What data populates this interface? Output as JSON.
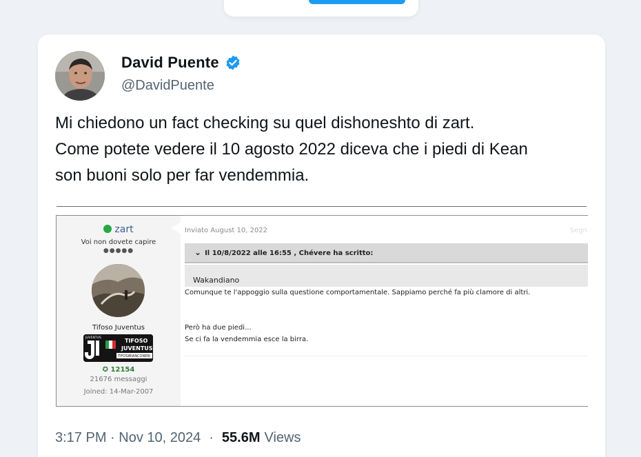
{
  "author": {
    "name": "David Puente",
    "handle": "@DavidPuente"
  },
  "tweet": {
    "lines": [
      "Mi chiedono un fact checking su quel dishoneshto di zart.",
      "Come potete vedere il 10 agosto 2022 diceva che i piedi di Kean",
      "son buoni solo per far vendemmia."
    ],
    "time": "3:17 PM · Nov 10, 2024",
    "separator": "·",
    "views_count": "55.6M",
    "views_label": "Views"
  },
  "embed": {
    "profile": {
      "username": "zart",
      "motto": "Voi non dovete capire",
      "stars": "●●●●●",
      "rank": "Tifoso Juventus",
      "badge_line1": "TIFOSO",
      "badge_line2": "JUVENTUS",
      "badge_line3": "TIFOSIBIANCONERI",
      "badge_small": "JUVENTUS",
      "reputation": "✪ 12154",
      "messages": "21676 messaggi",
      "joined": "Joined: 14-Mar-2007"
    },
    "post": {
      "date": "Inviato August 10, 2022",
      "share": "Segn",
      "quote_header": "Il 10/8/2022 alle 16:55 , Chévere ha scritto:",
      "quote_body": "Wakandiano",
      "line1": "Comunque te l'appoggio sulla questione comportamentale. Sappiamo perché fa più clamore di altri.",
      "line2": "Però ha due piedi...",
      "line3": "Se ci fa la vendemmia esce la birra."
    }
  },
  "colors": {
    "verified": "#1d9bf0",
    "online": "#27a844",
    "reputation": "#2e7d32"
  }
}
